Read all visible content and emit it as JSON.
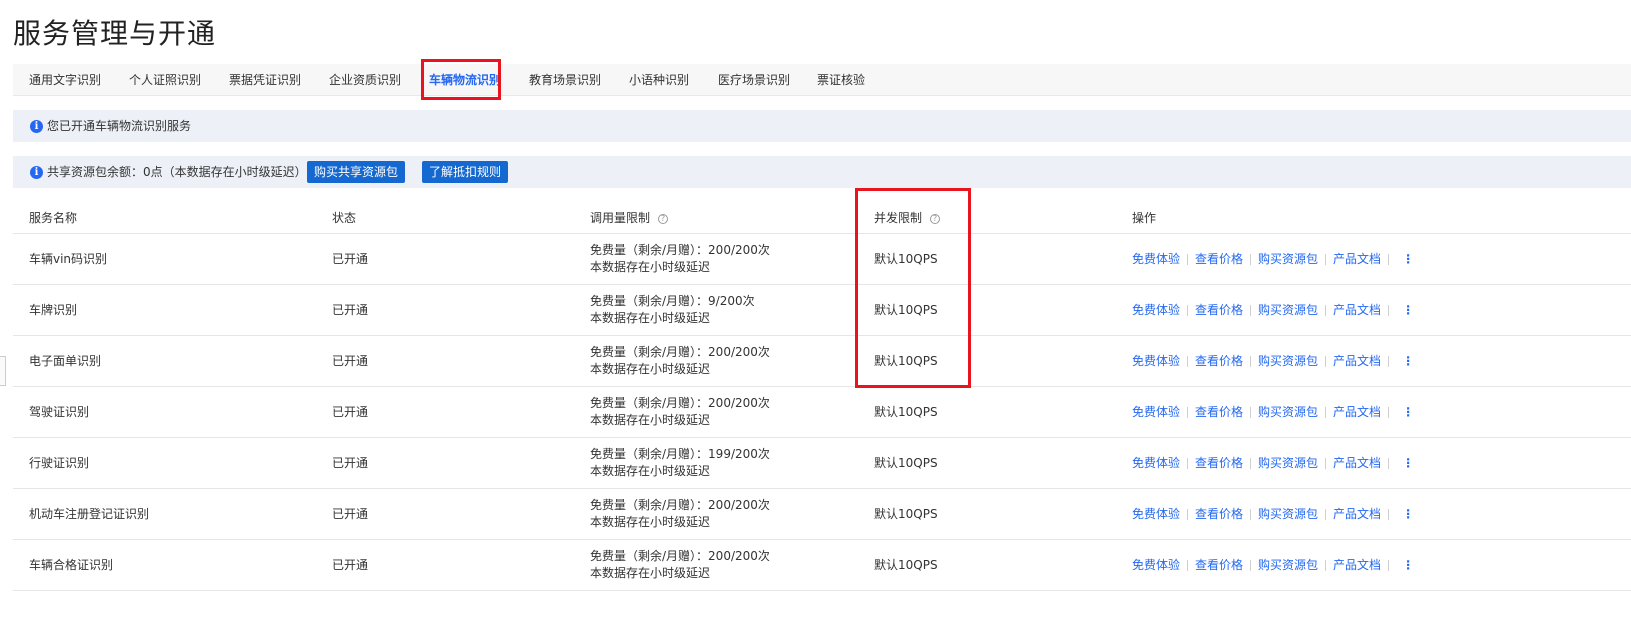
{
  "page": {
    "title": "服务管理与开通"
  },
  "tabs": [
    {
      "label": "通用文字识别",
      "active": false
    },
    {
      "label": "个人证照识别",
      "active": false
    },
    {
      "label": "票据凭证识别",
      "active": false
    },
    {
      "label": "企业资质识别",
      "active": false
    },
    {
      "label": "车辆物流识别",
      "active": true
    },
    {
      "label": "教育场景识别",
      "active": false
    },
    {
      "label": "小语种识别",
      "active": false
    },
    {
      "label": "医疗场景识别",
      "active": false
    },
    {
      "label": "票证核验",
      "active": false
    }
  ],
  "notice": {
    "text": "您已开通车辆物流识别服务",
    "icon": "info-icon"
  },
  "resource": {
    "text": "共享资源包余额：0点（本数据存在小时级延迟）",
    "buy_button": "购买共享资源包",
    "rules_button": "了解抵扣规则"
  },
  "table": {
    "headers": {
      "name": "服务名称",
      "status": "状态",
      "quota": "调用量限制",
      "concurrency": "并发限制",
      "actions": "操作"
    },
    "actions": {
      "trial": "免费体验",
      "price": "查看价格",
      "buy": "购买资源包",
      "docs": "产品文档"
    },
    "rows": [
      {
        "name": "车辆vin码识别",
        "status": "已开通",
        "quota": "免费量（剩余/月赠）：200/200次",
        "delay": "本数据存在小时级延迟",
        "concurrency": "默认10QPS"
      },
      {
        "name": "车牌识别",
        "status": "已开通",
        "quota": "免费量（剩余/月赠）：9/200次",
        "delay": "本数据存在小时级延迟",
        "concurrency": "默认10QPS"
      },
      {
        "name": "电子面单识别",
        "status": "已开通",
        "quota": "免费量（剩余/月赠）：200/200次",
        "delay": "本数据存在小时级延迟",
        "concurrency": "默认10QPS"
      },
      {
        "name": "驾驶证识别",
        "status": "已开通",
        "quota": "免费量（剩余/月赠）：200/200次",
        "delay": "本数据存在小时级延迟",
        "concurrency": "默认10QPS"
      },
      {
        "name": "行驶证识别",
        "status": "已开通",
        "quota": "免费量（剩余/月赠）：199/200次",
        "delay": "本数据存在小时级延迟",
        "concurrency": "默认10QPS"
      },
      {
        "name": "机动车注册登记证识别",
        "status": "已开通",
        "quota": "免费量（剩余/月赠）：200/200次",
        "delay": "本数据存在小时级延迟",
        "concurrency": "默认10QPS"
      },
      {
        "name": "车辆合格证识别",
        "status": "已开通",
        "quota": "免费量（剩余/月赠）：200/200次",
        "delay": "本数据存在小时级延迟",
        "concurrency": "默认10QPS"
      }
    ]
  },
  "colors": {
    "accent": "#2468f2",
    "button": "#1468cf",
    "highlight": "#e8141e",
    "bar_bg": "#edf1f7"
  }
}
